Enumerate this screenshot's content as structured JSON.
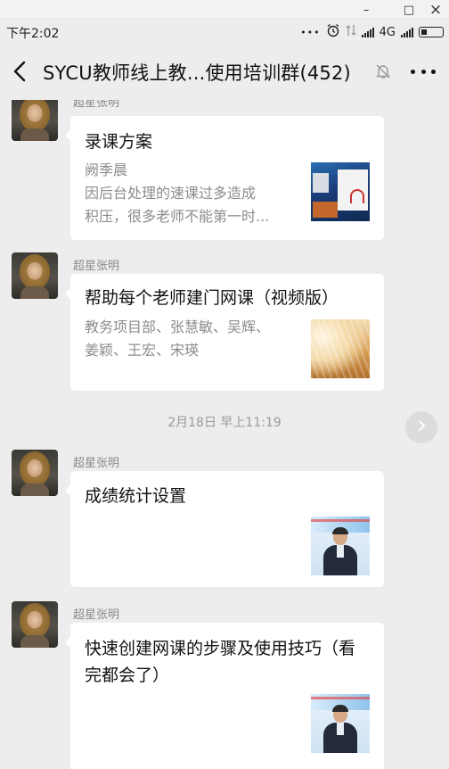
{
  "window": {
    "minimize": "–",
    "maximize": "□",
    "close": "×"
  },
  "status_bar": {
    "time": "下午2:02",
    "dots": "•••",
    "network": "4G"
  },
  "header": {
    "title": "SYCU教师线上教...使用培训群(452)"
  },
  "date_divider": "2月18日 早上11:19",
  "messages": [
    {
      "sender": "超星张明",
      "title": "录课方案",
      "description": "阙季晨\n因后台处理的速课过多造成\n积压，很多老师不能第一时...",
      "thumbnail": "screenshot-thumbnail"
    },
    {
      "sender": "超星张明",
      "title": "帮助每个老师建门网课（视频版）",
      "description": "教务项目部、张慧敏、吴辉、\n姜颖、王宏、宋瑛",
      "thumbnail": "wheat-field-thumbnail"
    },
    {
      "sender": "超星张明",
      "title": "成绩统计设置",
      "description": "",
      "thumbnail": "presenter-thumbnail"
    },
    {
      "sender": "超星张明",
      "title": "快速创建网课的步骤及使用技巧（看完都会了）",
      "description": "",
      "thumbnail": "presenter-thumbnail"
    }
  ],
  "colors": {
    "background": "#ededed",
    "card": "#ffffff",
    "muted_text": "#8c8c8c"
  }
}
